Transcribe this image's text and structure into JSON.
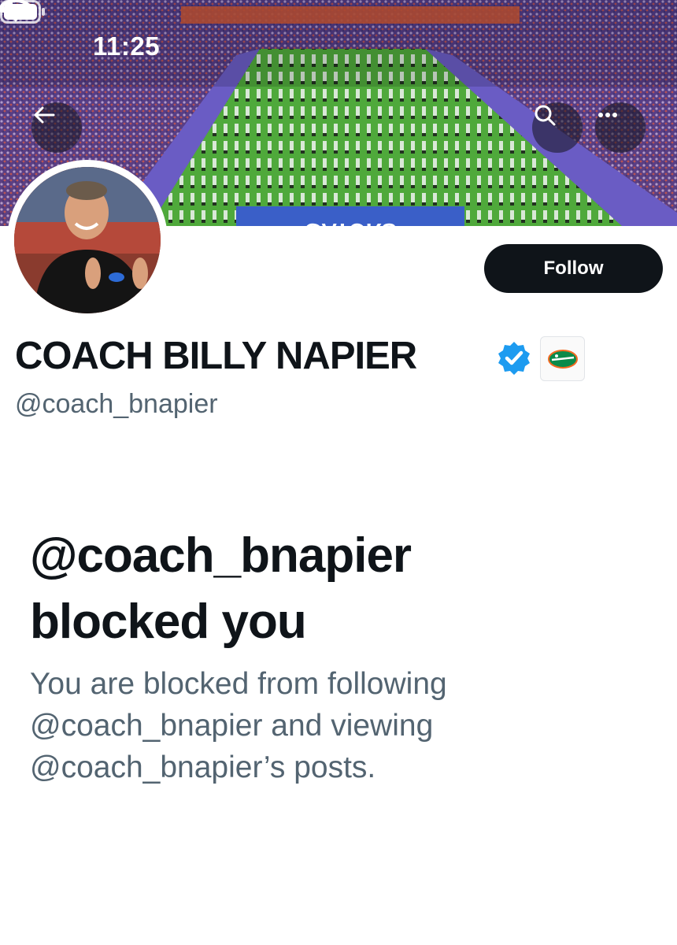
{
  "status_bar": {
    "time": "11:25"
  },
  "banner": {
    "description_icons": [
      "back-arrow-icon",
      "search-icon",
      "more-icon"
    ]
  },
  "profile": {
    "display_name": "COACH BILLY NAPIER",
    "handle": "@coach_bnapier",
    "follow_label": "Follow",
    "verified_color": "#1d9bf0"
  },
  "blocked": {
    "title_line1": "@coach_bnapier",
    "title_line2": "blocked you",
    "desc_line1": "You are blocked from following",
    "desc_line2": "@coach_bnapier and viewing",
    "desc_line3": "@coach_bnapier’s posts."
  },
  "colors": {
    "text_primary": "#0f1419",
    "text_secondary": "#536471",
    "button_bg": "#0f1419",
    "verified": "#1d9bf0"
  }
}
